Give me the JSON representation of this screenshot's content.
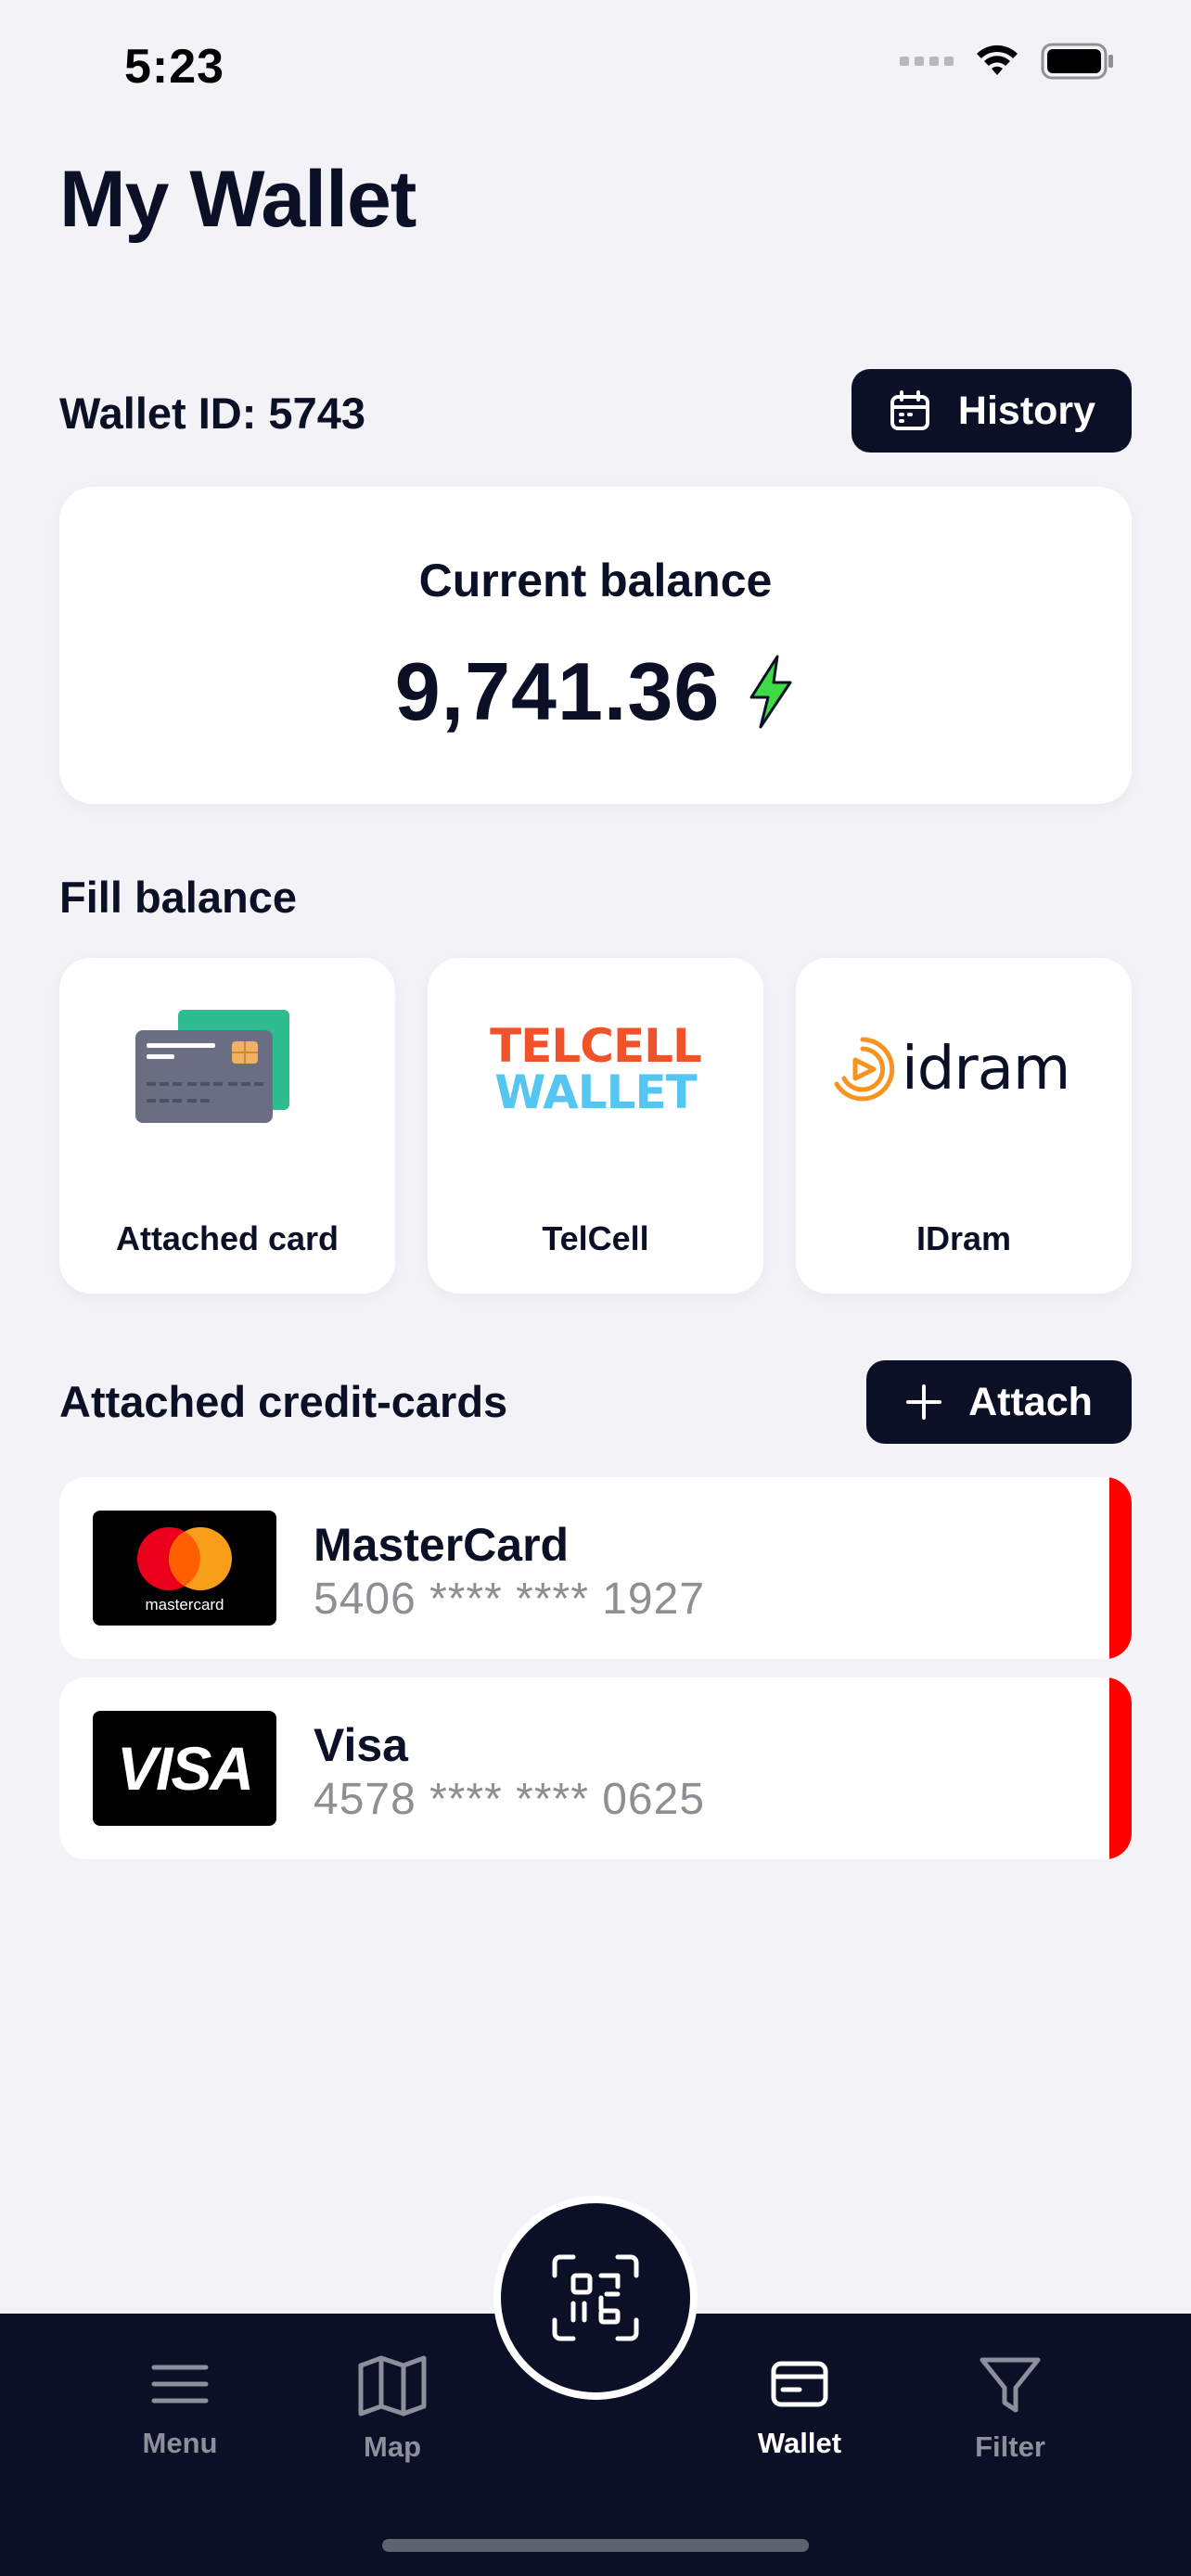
{
  "status_bar": {
    "time": "5:23"
  },
  "header": {
    "title": "My Wallet"
  },
  "wallet": {
    "id_label": "Wallet ID: 5743",
    "history_label": "History"
  },
  "balance": {
    "label": "Current balance",
    "value": "9,741.36"
  },
  "fill_balance": {
    "title": "Fill balance",
    "options": [
      {
        "label": "Attached card",
        "icon": "credit-card-icon"
      },
      {
        "label": "TelCell",
        "icon": "telcell-wallet-logo",
        "logo_line1": "TELCELL",
        "logo_line2": "WALLET"
      },
      {
        "label": "IDram",
        "icon": "idram-logo",
        "logo_text": "idram"
      }
    ]
  },
  "credit_cards": {
    "title": "Attached credit-cards",
    "attach_label": "Attach",
    "items": [
      {
        "name": "MasterCard",
        "number": "5406 **** **** 1927",
        "logo_text": "mastercard"
      },
      {
        "name": "Visa",
        "number": "4578 **** **** 0625",
        "logo_text": "VISA"
      }
    ]
  },
  "tab_bar": {
    "tabs": [
      {
        "label": "Menu",
        "icon": "menu-icon",
        "active": false
      },
      {
        "label": "Map",
        "icon": "map-icon",
        "active": false
      },
      {
        "label": "Wallet",
        "icon": "wallet-icon",
        "active": true
      },
      {
        "label": "Filter",
        "icon": "filter-icon",
        "active": false
      }
    ],
    "center_icon": "qr-scan-icon"
  },
  "colors": {
    "navy": "#0B1026",
    "background": "#F2F2F7",
    "stripe_red": "#FF0000",
    "bolt_green": "#3DDC47",
    "telcell_orange": "#F0522A",
    "telcell_blue": "#54C6F2",
    "idram_orange": "#F7931E"
  }
}
